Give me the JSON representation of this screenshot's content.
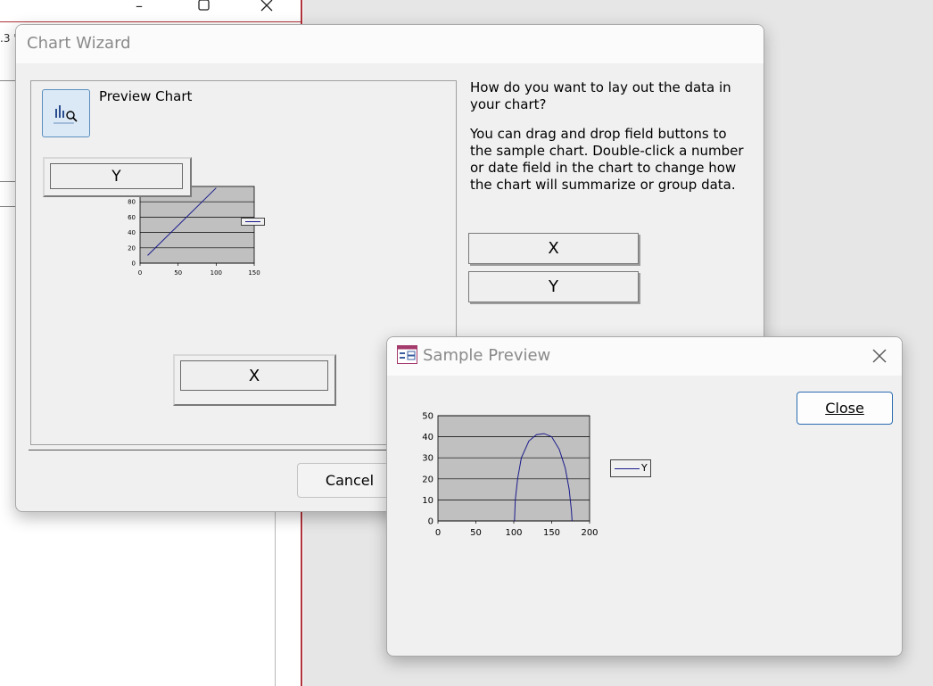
{
  "background_app": {
    "partial_text": ".3 '"
  },
  "chart_wizard": {
    "title": "Chart Wizard",
    "preview_chart_label": "Preview Chart",
    "drop_y_label": "Y",
    "drop_x_label": "X",
    "question": "How do you want to lay out the data in your chart?",
    "instructions": "You can drag and drop field buttons to the sample chart. Double-click a number or date field in the chart to change how the chart will summarize or group data.",
    "field_buttons": [
      "X",
      "Y"
    ],
    "cancel_label": "Cancel"
  },
  "sample_preview": {
    "title": "Sample Preview",
    "close_label": "Close",
    "close_icon": "close-icon",
    "window_icon": "form-icon"
  },
  "chart_data": [
    {
      "type": "line",
      "xlim": [
        0,
        150
      ],
      "ylim": [
        0,
        100
      ],
      "x_ticks": [
        "0",
        "50",
        "100",
        "150"
      ],
      "y_ticks": [
        "0",
        "20",
        "40",
        "60",
        "80"
      ],
      "series": [
        {
          "values": [
            [
              10,
              10
            ],
            [
              100,
              98
            ]
          ],
          "color": "#1a1a8c"
        }
      ],
      "grid": true,
      "plot_background": "#c0c0c0"
    },
    {
      "type": "line",
      "xlim": [
        0,
        200
      ],
      "ylim": [
        0,
        50
      ],
      "x_ticks": [
        "0",
        "50",
        "100",
        "150",
        "200"
      ],
      "y_ticks": [
        "0",
        "10",
        "20",
        "30",
        "40",
        "50"
      ],
      "series": [
        {
          "name": "Y",
          "color": "#1a1a8c",
          "values": [
            [
              101,
              0
            ],
            [
              102,
              10
            ],
            [
              105,
              20
            ],
            [
              110,
              30
            ],
            [
              120,
              38
            ],
            [
              130,
              41
            ],
            [
              140,
              41.5
            ],
            [
              150,
              40
            ],
            [
              160,
              34
            ],
            [
              168,
              25
            ],
            [
              173,
              15
            ],
            [
              176,
              5
            ],
            [
              177,
              0
            ]
          ]
        }
      ],
      "grid": true,
      "legend": "right",
      "plot_background": "#c0c0c0"
    }
  ]
}
